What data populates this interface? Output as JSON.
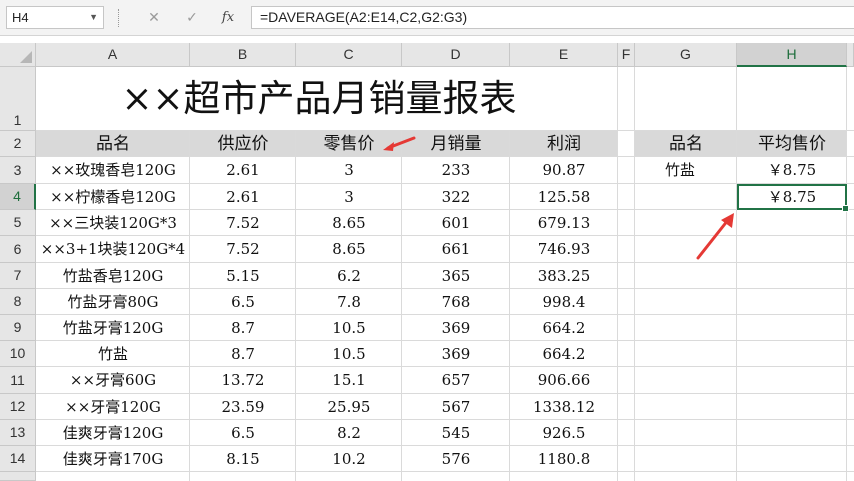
{
  "formula_bar": {
    "name_box": "H4",
    "cancel_icon": "✕",
    "enter_icon": "✓",
    "fx_label": "fx",
    "formula": "=DAVERAGE(A2:E14,C2,G2:G3)"
  },
  "columns": [
    "A",
    "B",
    "C",
    "D",
    "E",
    "F",
    "G",
    "H"
  ],
  "selected_column": "H",
  "rows": [
    "1",
    "2",
    "3",
    "4",
    "5",
    "6",
    "7",
    "8",
    "9",
    "10",
    "11",
    "12",
    "13",
    "14"
  ],
  "selected_row": "4",
  "title": "××超市产品月销量报表",
  "table": {
    "headers": [
      "品名",
      "供应价",
      "零售价",
      "月销量",
      "利润"
    ],
    "rows": [
      [
        "××玫瑰香皂120G",
        "2.61",
        "3",
        "233",
        "90.87"
      ],
      [
        "××柠檬香皂120G",
        "2.61",
        "3",
        "322",
        "125.58"
      ],
      [
        "××三块装120G*3",
        "7.52",
        "8.65",
        "601",
        "679.13"
      ],
      [
        "××3+1块装120G*4",
        "7.52",
        "8.65",
        "661",
        "746.93"
      ],
      [
        "竹盐香皂120G",
        "5.15",
        "6.2",
        "365",
        "383.25"
      ],
      [
        "竹盐牙膏80G",
        "6.5",
        "7.8",
        "768",
        "998.4"
      ],
      [
        "竹盐牙膏120G",
        "8.7",
        "10.5",
        "369",
        "664.2"
      ],
      [
        "竹盐",
        "8.7",
        "10.5",
        "369",
        "664.2"
      ],
      [
        "××牙膏60G",
        "13.72",
        "15.1",
        "657",
        "906.66"
      ],
      [
        "××牙膏120G",
        "23.59",
        "25.95",
        "567",
        "1338.12"
      ],
      [
        "佳爽牙膏120G",
        "6.5",
        "8.2",
        "545",
        "926.5"
      ],
      [
        "佳爽牙膏170G",
        "8.15",
        "10.2",
        "576",
        "1180.8"
      ]
    ]
  },
  "criteria": {
    "headers": [
      "品名",
      "平均售价"
    ],
    "values": [
      "竹盐",
      "￥8.75"
    ],
    "result": "￥8.75"
  },
  "colors": {
    "accent": "#217346",
    "arrow": "#e53935",
    "header_band": "#d9d9d9"
  }
}
